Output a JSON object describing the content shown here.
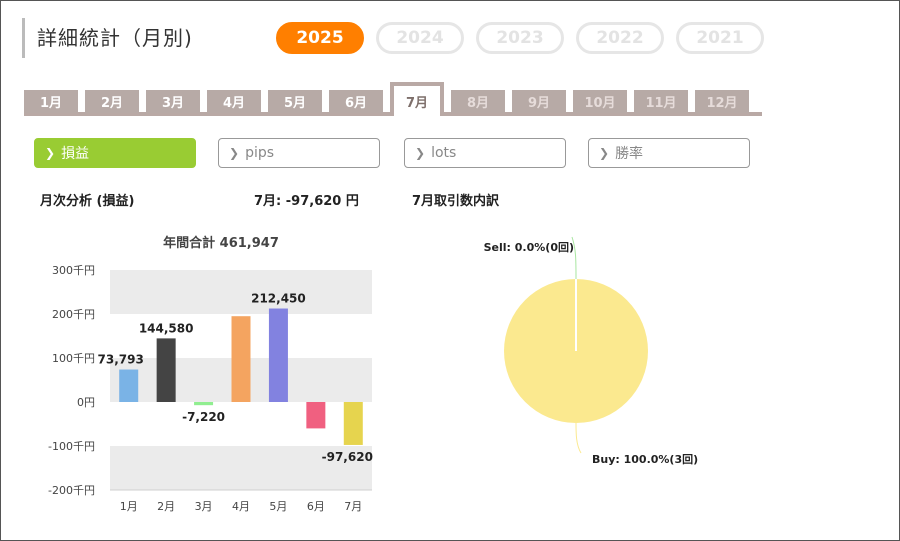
{
  "header": {
    "title": "詳細統計（月別)"
  },
  "years": [
    {
      "label": "2025",
      "active": true
    },
    {
      "label": "2024",
      "active": false
    },
    {
      "label": "2023",
      "active": false
    },
    {
      "label": "2022",
      "active": false
    },
    {
      "label": "2021",
      "active": false
    }
  ],
  "months": [
    "1月",
    "2月",
    "3月",
    "4月",
    "5月",
    "6月",
    "7月",
    "8月",
    "9月",
    "10月",
    "11月",
    "12月"
  ],
  "active_month_index": 6,
  "metrics": [
    {
      "label": "損益",
      "active": true
    },
    {
      "label": "pips",
      "active": false
    },
    {
      "label": "lots",
      "active": false
    },
    {
      "label": "勝率",
      "active": false
    }
  ],
  "section": {
    "monthly_analysis_label": "月次分析 (損益)",
    "month_value_label": "7月:  -97,620 円",
    "breakdown_label": "7月取引数内訳"
  },
  "colors": {
    "accent": "#ff7f00",
    "metric_active": "#99cc33",
    "tab": "#b7aaa6"
  },
  "chart_data": [
    {
      "type": "bar",
      "title": "年間合計 461,947",
      "categories": [
        "1月",
        "2月",
        "3月",
        "4月",
        "5月",
        "6月",
        "7月"
      ],
      "values": [
        73793,
        144580,
        -7220,
        195000,
        212450,
        -60000,
        -97620
      ],
      "value_labels": [
        "73,793",
        "144,580",
        "-7,220",
        "",
        "212,450",
        "",
        "-97,620"
      ],
      "bar_colors": [
        "#7ab3e6",
        "#444444",
        "#90ee90",
        "#f4a460",
        "#8282e0",
        "#f06080",
        "#e6d44e"
      ],
      "ylim": [
        -200000,
        300000
      ],
      "yticks": [
        300000,
        200000,
        100000,
        0,
        -100000,
        -200000
      ],
      "ytick_labels": [
        "300千円",
        "200千円",
        "100千円",
        "0円",
        "-100千円",
        "-200千円"
      ],
      "grid": true,
      "band_colors": [
        "#ebebeb",
        "#ffffff"
      ]
    },
    {
      "type": "pie",
      "labels": [
        "Sell",
        "Buy"
      ],
      "values": [
        0,
        100
      ],
      "slice_labels": [
        "Sell: 0.0%(0回)",
        "Buy: 100.0%(3回)"
      ],
      "colors": [
        "#a8e6a0",
        "#fbe98f"
      ]
    }
  ]
}
